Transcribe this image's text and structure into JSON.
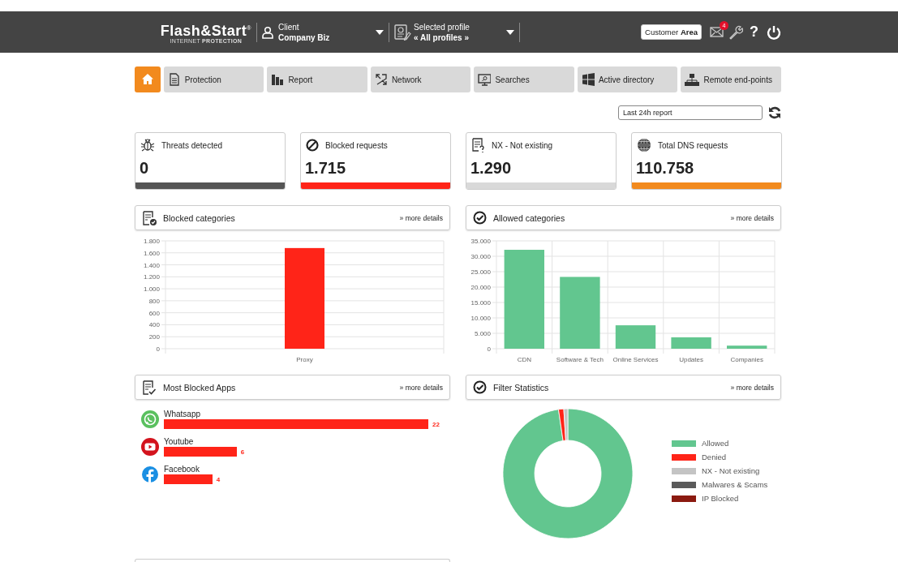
{
  "header": {
    "logo": "Flash&Start$^{®}$",
    "tagline": "INTERNET **PROTECTION**",
    "client": {
      "label": "Client",
      "value": "Company Biz"
    },
    "profile": {
      "label": "Selected profile",
      "value": "« All profiles »"
    },
    "customer_area": "Customer **Area**",
    "mail_badge": "4",
    "help": "?"
  },
  "nav": [
    {
      "kind": "home",
      "selected": true
    },
    {
      "kind": "tab",
      "label": "Protection",
      "selected": false
    },
    {
      "kind": "tab",
      "label": "Report",
      "selected": false
    },
    {
      "kind": "tab",
      "label": "Network",
      "selected": false
    },
    {
      "kind": "tab",
      "label": "Searches",
      "selected": false
    },
    {
      "kind": "tab",
      "label": "Active directory",
      "selected": false
    },
    {
      "kind": "tab",
      "label": "Remote end-points",
      "selected": false
    }
  ],
  "report_select": {
    "value": "Last 24h report"
  },
  "stats": [
    {
      "label": "Threats detected",
      "value": "0",
      "color": "#555555"
    },
    {
      "label": "Blocked requests",
      "value": "1.715",
      "color": "#ff2418"
    },
    {
      "label": "NX - Not existing",
      "value": "1.290",
      "color": "#d9d9d9"
    },
    {
      "label": "Total DNS requests",
      "value": "110.758",
      "color": "#f28a1e"
    }
  ],
  "panels": [
    {
      "kind": "bar_chart",
      "title": "Blocked categories",
      "link": "» more details",
      "chart_data": {
        "type": "bar",
        "categories": [
          "Proxy"
        ],
        "grid": true,
        "series": [
          {
            "color": "#ff2418",
            "values": [
              1680
            ]
          }
        ],
        "ylim": [
          0,
          1800
        ],
        "yticks": [
          {
            "value": 0,
            "label": "0"
          },
          {
            "value": 200,
            "label": "200"
          },
          {
            "value": 400,
            "label": "400"
          },
          {
            "value": 600,
            "label": "600"
          },
          {
            "value": 800,
            "label": "800"
          },
          {
            "value": 1000,
            "label": "1.000"
          },
          {
            "value": 1200,
            "label": "1.200"
          },
          {
            "value": 1400,
            "label": "1.400"
          },
          {
            "value": 1600,
            "label": "1.600"
          },
          {
            "value": 1800,
            "label": "1.800"
          }
        ]
      }
    },
    {
      "kind": "bar_chart",
      "title": "Allowed categories",
      "link": "» more details",
      "chart_data": {
        "type": "bar",
        "categories": [
          "CDN",
          "Software & Tech",
          "Online Services",
          "Updates",
          "Companies"
        ],
        "grid": true,
        "series": [
          {
            "color": "#62c68f",
            "values": [
              32100,
              23300,
              7600,
              3700,
              1000
            ]
          }
        ],
        "ylim": [
          0,
          35000
        ],
        "yticks": [
          {
            "value": 0,
            "label": "0"
          },
          {
            "value": 5000,
            "label": "5.000"
          },
          {
            "value": 10000,
            "label": "10.000"
          },
          {
            "value": 15000,
            "label": "15.000"
          },
          {
            "value": 20000,
            "label": "20.000"
          },
          {
            "value": 25000,
            "label": "25.000"
          },
          {
            "value": 30000,
            "label": "30.000"
          },
          {
            "value": 35000,
            "label": "35.000"
          }
        ]
      }
    },
    {
      "kind": "apps",
      "title": "Most Blocked Apps",
      "link": "» more details",
      "apps": [
        {
          "name": "Whatsapp",
          "count": "22"
        },
        {
          "name": "Youtube",
          "count": "6"
        },
        {
          "name": "Facebook",
          "count": "4"
        }
      ]
    },
    {
      "kind": "donut",
      "title": "Filter Statistics",
      "link": "» more details",
      "legend": [
        {
          "label": "Allowed",
          "color": "#62c68f"
        },
        {
          "label": "Denied",
          "color": "#ff2418"
        },
        {
          "label": "NX - Not existing",
          "color": "#c4c4c4"
        },
        {
          "label": "Malwares & Scams",
          "color": "#5a5a5a"
        },
        {
          "label": "IP Blocked",
          "color": "#8b1a10"
        }
      ]
    }
  ]
}
